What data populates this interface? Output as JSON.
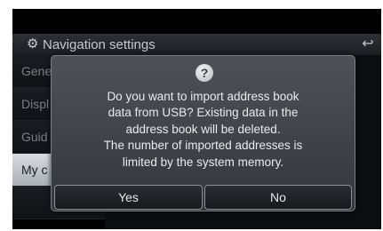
{
  "header": {
    "title": "Navigation settings",
    "icon": "gear-icon",
    "back_icon": "back-arrow-icon"
  },
  "menu": {
    "items": [
      {
        "label": "Gene",
        "selected": false
      },
      {
        "label": "Displ",
        "selected": false
      },
      {
        "label": "Guid",
        "selected": false
      },
      {
        "label": "My c",
        "selected": true
      }
    ]
  },
  "dialog": {
    "icon": "question-icon",
    "icon_glyph": "?",
    "message_lines": [
      "Do you want to import address book",
      "data from USB? Existing data in the",
      "address book will be deleted.",
      "The number of imported addresses is",
      "limited by the system memory."
    ],
    "yes_label": "Yes",
    "no_label": "No"
  }
}
